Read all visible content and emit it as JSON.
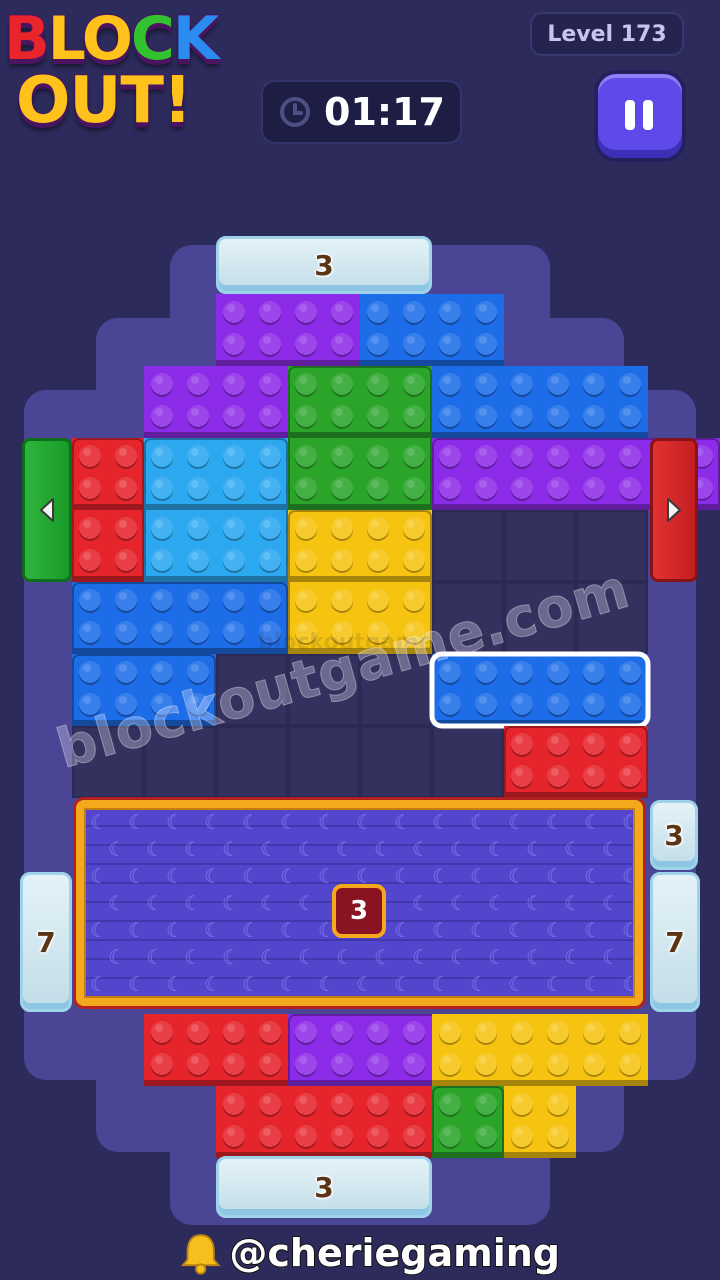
{
  "header": {
    "logo": {
      "word1": [
        "B",
        "L",
        "O",
        "C",
        "K"
      ],
      "word2": "OUT!"
    },
    "level_label": "Level 173",
    "timer": "01:17",
    "icons": {
      "timer": "clock-icon",
      "pause": "pause-icon"
    }
  },
  "board": {
    "gates": {
      "top": "3",
      "bottom": "3",
      "right_upper": "3",
      "left_lower": "7",
      "right_lower": "7"
    },
    "panel_counter": "3",
    "doors": {
      "left": {
        "color": "#1fa62e",
        "icon": "arrow-left-icon"
      },
      "right": {
        "color": "#d92a2b",
        "icon": "arrow-right-icon"
      }
    }
  },
  "pieces": {
    "colors": {
      "purple": "#8d2ce8",
      "blue": "#1d6de9",
      "green": "#2ba42a",
      "red": "#e6242c",
      "cyan": "#2ba8f0",
      "yellow": "#f6c311"
    }
  },
  "watermark": "blockoutgame.com",
  "footer": {
    "handle": "@cheriegaming",
    "icon": "bell-icon"
  }
}
